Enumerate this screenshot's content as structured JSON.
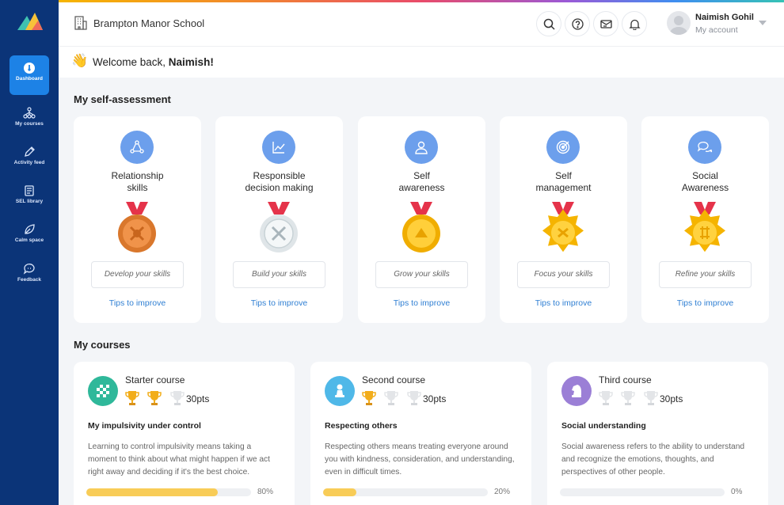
{
  "topbar": {
    "school_name": "Brampton Manor School",
    "user_name": "Naimish Gohil",
    "user_subtitle": "My account"
  },
  "sidebar": {
    "items": [
      {
        "label": "Dashboard",
        "icon": "dashboard-icon",
        "active": true
      },
      {
        "label": "My courses",
        "icon": "courses-icon"
      },
      {
        "label": "Activity feed",
        "icon": "pencil-icon"
      },
      {
        "label": "SEL library",
        "icon": "library-icon"
      },
      {
        "label": "Calm space",
        "icon": "leaf-icon"
      },
      {
        "label": "Feedback",
        "icon": "chat-icon"
      }
    ]
  },
  "welcome": {
    "greeting": "Welcome back, ",
    "name": "Naimish!"
  },
  "self_assessment": {
    "title": "My self-assessment",
    "cards": [
      {
        "title_line1": "Relationship",
        "title_line2": "skills",
        "button": "Develop your skills",
        "link": "Tips to improve",
        "medal": "bronze"
      },
      {
        "title_line1": "Responsible",
        "title_line2": "decision making",
        "button": "Build your skills",
        "link": "Tips to improve",
        "medal": "silver"
      },
      {
        "title_line1": "Self",
        "title_line2": "awareness",
        "button": "Grow your skills",
        "link": "Tips to improve",
        "medal": "gold-round"
      },
      {
        "title_line1": "Self",
        "title_line2": "management",
        "button": "Focus your skills",
        "link": "Tips to improve",
        "medal": "gold-star"
      },
      {
        "title_line1": "Social",
        "title_line2": "Awareness",
        "button": "Refine your skills",
        "link": "Tips to improve",
        "medal": "gold-star"
      }
    ]
  },
  "courses": {
    "title": "My courses",
    "cards": [
      {
        "name": "Starter course",
        "points": "30pts",
        "trophies_earned": 2,
        "subtitle": "My impulsivity under control",
        "description": "Learning to control impulsivity means taking a moment to think about what might happen if we act right away and deciding if it's the best choice.",
        "progress": 0.8,
        "progress_label": "80%",
        "icon_color": "#2fb89a"
      },
      {
        "name": "Second course",
        "points": "30pts",
        "trophies_earned": 1,
        "subtitle": "Respecting others",
        "description": "Respecting others means treating everyone around you with kindness, consideration, and understanding, even in difficult times.",
        "progress": 0.2,
        "progress_label": "20%",
        "icon_color": "#4fb8e8"
      },
      {
        "name": "Third course",
        "points": "30pts",
        "trophies_earned": 0,
        "subtitle": "Social understanding",
        "description": "Social awareness refers to the ability to understand and recognize the emotions, thoughts, and perspectives of other people.",
        "progress": 0.0,
        "progress_label": "0%",
        "icon_color": "#9b7fd6"
      }
    ]
  },
  "colors": {
    "sidebar": "#0b3478",
    "accent": "#1d82e6",
    "link": "#2f7fd3",
    "progress": "#f8cc57"
  }
}
